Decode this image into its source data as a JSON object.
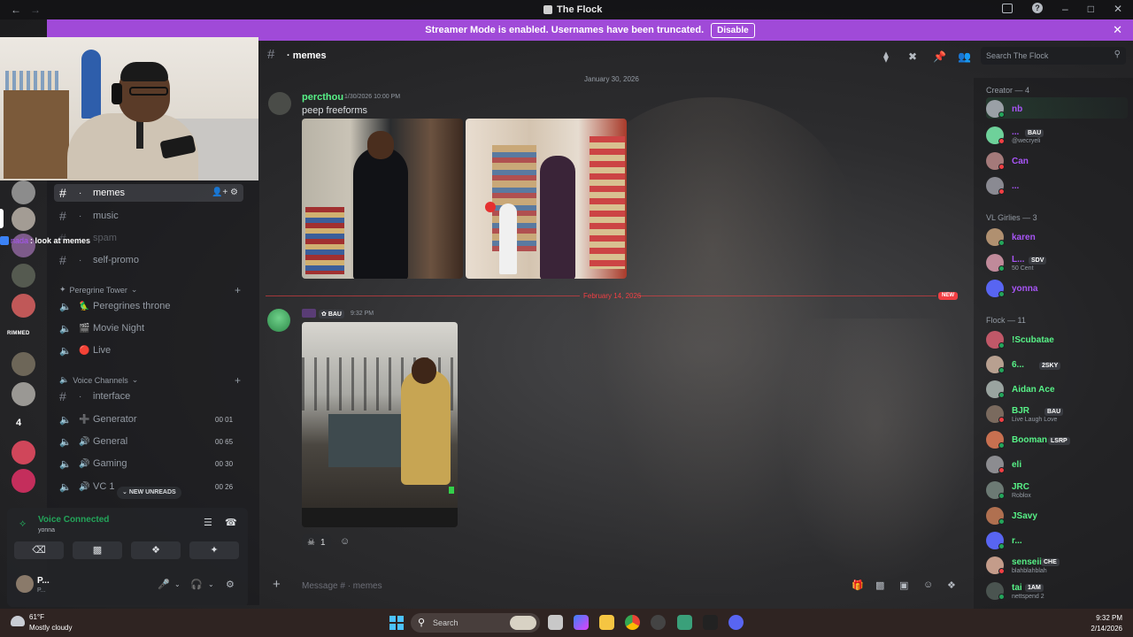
{
  "window": {
    "title": "The Flock"
  },
  "notice": {
    "text": "Streamer Mode is enabled. Usernames have been truncated.",
    "button": "Disable"
  },
  "rail": {
    "badge_text": "RIMMED",
    "count": "4"
  },
  "chat_overlay": {
    "author": "nada",
    "message": ": look at memes"
  },
  "channels": [
    {
      "name": "memes",
      "kind": "text",
      "emoji": "·"
    },
    {
      "name": "music",
      "kind": "text",
      "emoji": "·"
    },
    {
      "name": "spam",
      "kind": "text",
      "emoji": "·"
    },
    {
      "name": "self-promo",
      "kind": "text",
      "emoji": "·"
    }
  ],
  "category_peregrine": {
    "name": "Peregrine Tower"
  },
  "peregrine_channels": [
    {
      "name": "Peregrines throne",
      "emoji": "🦜"
    },
    {
      "name": "Movie Night",
      "emoji": "🎬"
    },
    {
      "name": "Live",
      "emoji": "🔴"
    }
  ],
  "category_voice": {
    "name": "Voice Channels"
  },
  "voice_channels": [
    {
      "name": "interface",
      "kind": "text",
      "emoji": "·",
      "counts": ""
    },
    {
      "name": "Generator",
      "kind": "voice",
      "emoji": "➕",
      "counts": "00  01"
    },
    {
      "name": "General",
      "kind": "voice",
      "emoji": "🔊",
      "counts": "00  65"
    },
    {
      "name": "Gaming",
      "kind": "voice",
      "emoji": "🔊",
      "counts": "00  30"
    },
    {
      "name": "VC 1",
      "kind": "voice",
      "emoji": "🔊",
      "counts": "00  26"
    }
  ],
  "new_unreads": "NEW UNREADS",
  "voice": {
    "status": "Voice Connected",
    "channel": "yonna"
  },
  "user": {
    "name": "P...",
    "status": "P..."
  },
  "header": {
    "channel": "memes",
    "search_placeholder": "Search The Flock"
  },
  "messages": {
    "date1": "January 30, 2026",
    "m1_author": "percthou",
    "m1_time": "1/30/2026 10:00 PM",
    "m1_text": "peep freeforms",
    "date2": "February 14, 2026",
    "new_label": "NEW",
    "m2_tag": "BAU",
    "m2_time": "9:32 PM",
    "reaction_count": "1"
  },
  "composer": {
    "placeholder": "Message # · memes"
  },
  "member_groups": {
    "creator": "Creator — 4",
    "vl": "VL Girlies — 3",
    "flock": "Flock — 11"
  },
  "creator_members": [
    {
      "name": "nb",
      "sub": "",
      "tag": "",
      "color": "#a855f7"
    },
    {
      "name": "...",
      "sub": "@wecryeli",
      "tag": "BAU",
      "color": "#a855f7"
    },
    {
      "name": "Can",
      "sub": "",
      "tag": "",
      "color": "#a855f7"
    },
    {
      "name": "...",
      "sub": "",
      "tag": "",
      "color": "#a855f7"
    }
  ],
  "vl_members": [
    {
      "name": "karen",
      "sub": "",
      "tag": "",
      "color": "#a855f7"
    },
    {
      "name": "L...",
      "sub": "50 Cent",
      "tag": "SDV",
      "color": "#a855f7"
    },
    {
      "name": "yonna",
      "sub": "",
      "tag": "",
      "color": "#a855f7"
    }
  ],
  "flock_members": [
    {
      "name": "!Scubatae",
      "sub": "",
      "tag": "",
      "color": "#57f287"
    },
    {
      "name": "6...",
      "sub": "",
      "tag": "2SKY",
      "color": "#57f287"
    },
    {
      "name": "Aidan Ace",
      "sub": "",
      "tag": "",
      "color": "#57f287"
    },
    {
      "name": "BJR",
      "sub": "Live Laugh Love",
      "tag": "BAU",
      "color": "#57f287"
    },
    {
      "name": "Booman",
      "sub": "",
      "tag": "LSRP",
      "color": "#57f287"
    },
    {
      "name": "eli",
      "sub": "",
      "tag": "",
      "color": "#57f287"
    },
    {
      "name": "JRC",
      "sub": "Roblox",
      "tag": "",
      "color": "#57f287"
    },
    {
      "name": "JSavy",
      "sub": "",
      "tag": "",
      "color": "#57f287"
    },
    {
      "name": "r...",
      "sub": "",
      "tag": "",
      "color": "#57f287"
    },
    {
      "name": "senseii",
      "sub": "blahblahblah",
      "tag": "CHE",
      "color": "#57f287"
    },
    {
      "name": "tai",
      "sub": "nettspend 2",
      "tag": "1AM",
      "color": "#57f287"
    }
  ],
  "taskbar": {
    "temp": "61°F",
    "weather": "Mostly cloudy",
    "search": "Search",
    "time": "9:32 PM",
    "date": "2/14/2026"
  },
  "colors": {
    "notice": "#a04ad8",
    "online": "#23a55a",
    "new": "#f23f43"
  }
}
